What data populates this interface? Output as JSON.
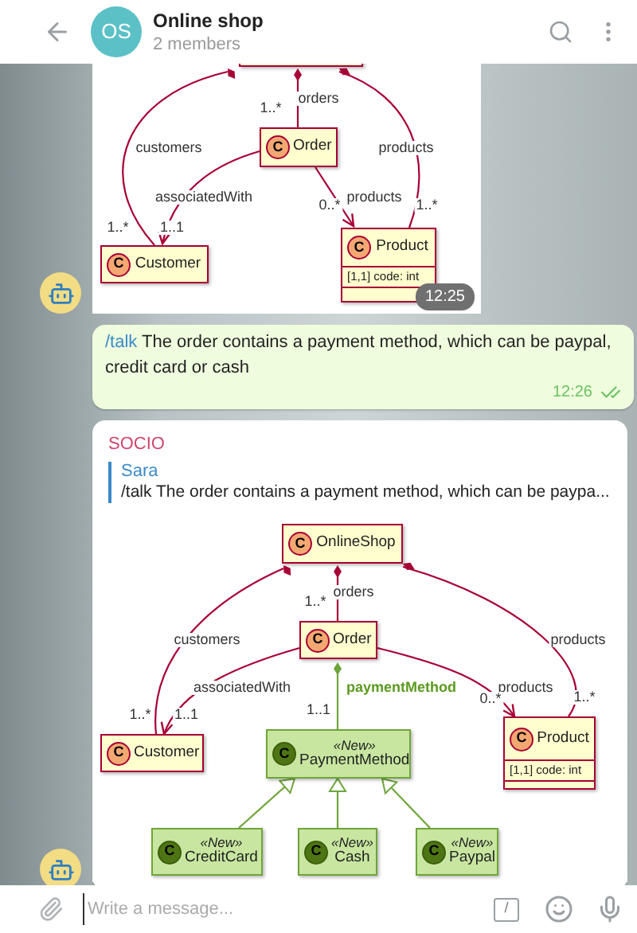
{
  "header": {
    "avatar_initials": "OS",
    "title": "Online shop",
    "subtitle": "2 members"
  },
  "messages": [
    {
      "kind": "diagram",
      "time": "12:25",
      "diagram": {
        "nodes": [
          {
            "new": false
          },
          {
            "marker": "C",
            "label": "Order",
            "new": false
          },
          {
            "marker": "C",
            "label": "Customer",
            "new": false
          },
          {
            "marker": "C",
            "label": "Product",
            "attributes": [
              "[1,1] code: int"
            ],
            "new": false
          }
        ],
        "edges": [
          {
            "kind": "composition",
            "name": "customers",
            "multiplicity": "1..*",
            "new": false
          },
          {
            "kind": "composition",
            "name": "orders",
            "multiplicity": "1..*",
            "new": false
          },
          {
            "kind": "composition",
            "name": "products",
            "multiplicity": "1..*",
            "new": false
          },
          {
            "kind": "association",
            "name": "associatedWith",
            "multiplicity": "1..1",
            "new": false
          },
          {
            "kind": "association",
            "name": "products",
            "multiplicity": "0..*",
            "new": false
          }
        ]
      }
    },
    {
      "kind": "outgoing",
      "command": "/talk",
      "text": "The order contains a payment method, which can be paypal, credit card or cash",
      "time": "12:26",
      "read": true
    },
    {
      "kind": "reply_diagram",
      "sender": "SOCIO",
      "reply": {
        "author": "Sara",
        "text": "/talk The order contains a payment method, which can be paypa..."
      },
      "diagram": {
        "nodes": [
          {
            "marker": "C",
            "label": "OnlineShop",
            "new": false
          },
          {
            "marker": "C",
            "label": "Order",
            "new": false
          },
          {
            "marker": "C",
            "label": "Customer",
            "new": false
          },
          {
            "marker": "C",
            "stereotype": "«New»",
            "label": "PaymentMethod",
            "new": true
          },
          {
            "marker": "C",
            "label": "Product",
            "attributes": [
              "[1,1] code: int"
            ],
            "new": false
          },
          {
            "marker": "C",
            "stereotype": "«New»",
            "label": "CreditCard",
            "new": true
          },
          {
            "marker": "C",
            "stereotype": "«New»",
            "label": "Cash",
            "new": true
          },
          {
            "marker": "C",
            "stereotype": "«New»",
            "label": "Paypal",
            "new": true
          }
        ],
        "edges": [
          {
            "kind": "composition",
            "name": "customers",
            "multiplicity": "1..*",
            "new": false
          },
          {
            "kind": "composition",
            "name": "orders",
            "multiplicity": "1..*",
            "new": false
          },
          {
            "kind": "composition",
            "name": "products",
            "multiplicity": "1..*",
            "new": false
          },
          {
            "kind": "association",
            "name": "associatedWith",
            "multiplicity": "1..1",
            "new": false
          },
          {
            "kind": "composition",
            "name": "paymentMethod",
            "multiplicity": "1..1",
            "new": true
          },
          {
            "kind": "association",
            "name": "products",
            "multiplicity": "0..*",
            "new": false
          },
          {
            "kind": "generalization",
            "new": true
          },
          {
            "kind": "generalization",
            "new": true
          },
          {
            "kind": "generalization",
            "new": true
          }
        ]
      }
    }
  ],
  "composer": {
    "placeholder": "Write a message...",
    "commands_button": "/"
  }
}
